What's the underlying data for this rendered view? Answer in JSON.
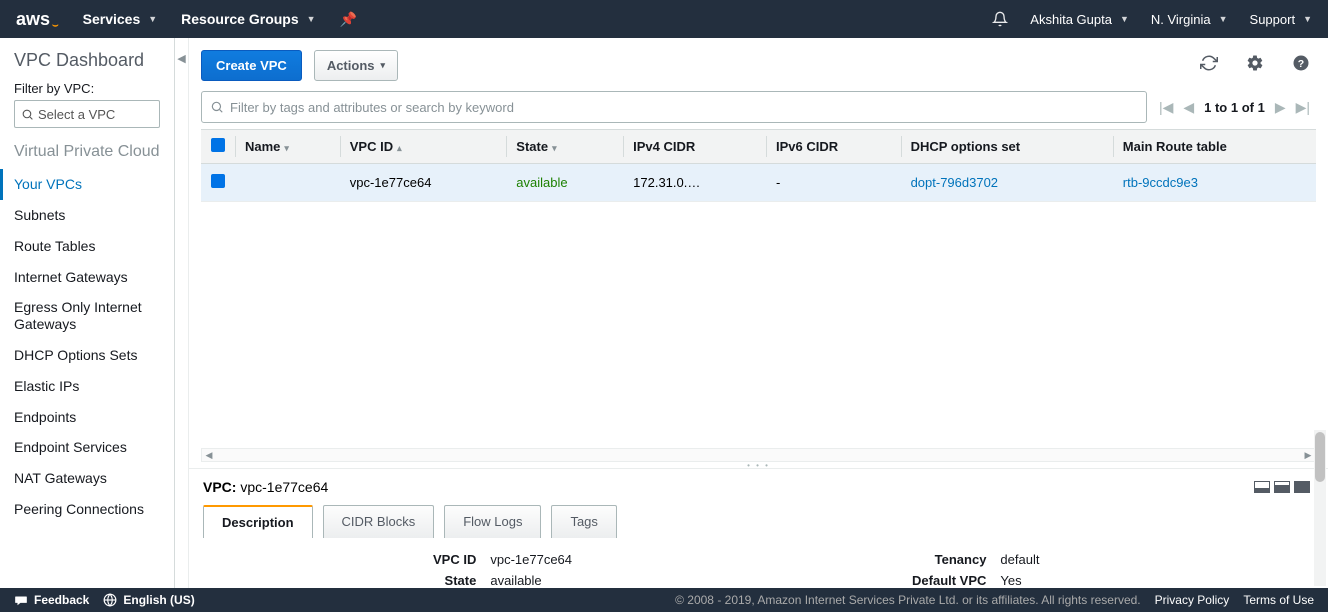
{
  "topnav": {
    "logo": "aws",
    "services": "Services",
    "resource_groups": "Resource Groups",
    "user": "Akshita Gupta",
    "region": "N. Virginia",
    "support": "Support"
  },
  "sidebar": {
    "title": "VPC Dashboard",
    "filter_label": "Filter by VPC:",
    "filter_placeholder": "Select a VPC",
    "section": "Virtual Private Cloud",
    "links": [
      "Your VPCs",
      "Subnets",
      "Route Tables",
      "Internet Gateways",
      "Egress Only Internet Gateways",
      "DHCP Options Sets",
      "Elastic IPs",
      "Endpoints",
      "Endpoint Services",
      "NAT Gateways",
      "Peering Connections"
    ]
  },
  "toolbar": {
    "create": "Create VPC",
    "actions": "Actions"
  },
  "search": {
    "placeholder": "Filter by tags and attributes or search by keyword"
  },
  "paginator": {
    "text": "1 to 1 of 1"
  },
  "columns": [
    "Name",
    "VPC ID",
    "State",
    "IPv4 CIDR",
    "IPv6 CIDR",
    "DHCP options set",
    "Main Route table"
  ],
  "row": {
    "name": "",
    "vpc_id": "vpc-1e77ce64",
    "state": "available",
    "ipv4": "172.31.0.…",
    "ipv6": "-",
    "dhcp": "dopt-796d3702",
    "rtb": "rtb-9ccdc9e3"
  },
  "detail": {
    "title_prefix": "VPC:",
    "title_value": "vpc-1e77ce64",
    "tabs": [
      "Description",
      "CIDR Blocks",
      "Flow Logs",
      "Tags"
    ],
    "left": [
      {
        "k": "VPC ID",
        "v": "vpc-1e77ce64"
      },
      {
        "k": "State",
        "v": "available"
      }
    ],
    "right": [
      {
        "k": "Tenancy",
        "v": "default"
      },
      {
        "k": "Default VPC",
        "v": "Yes"
      }
    ]
  },
  "footer": {
    "feedback": "Feedback",
    "lang": "English (US)",
    "legal": "© 2008 - 2019, Amazon Internet Services Private Ltd. or its affiliates. All rights reserved.",
    "privacy": "Privacy Policy",
    "terms": "Terms of Use"
  }
}
